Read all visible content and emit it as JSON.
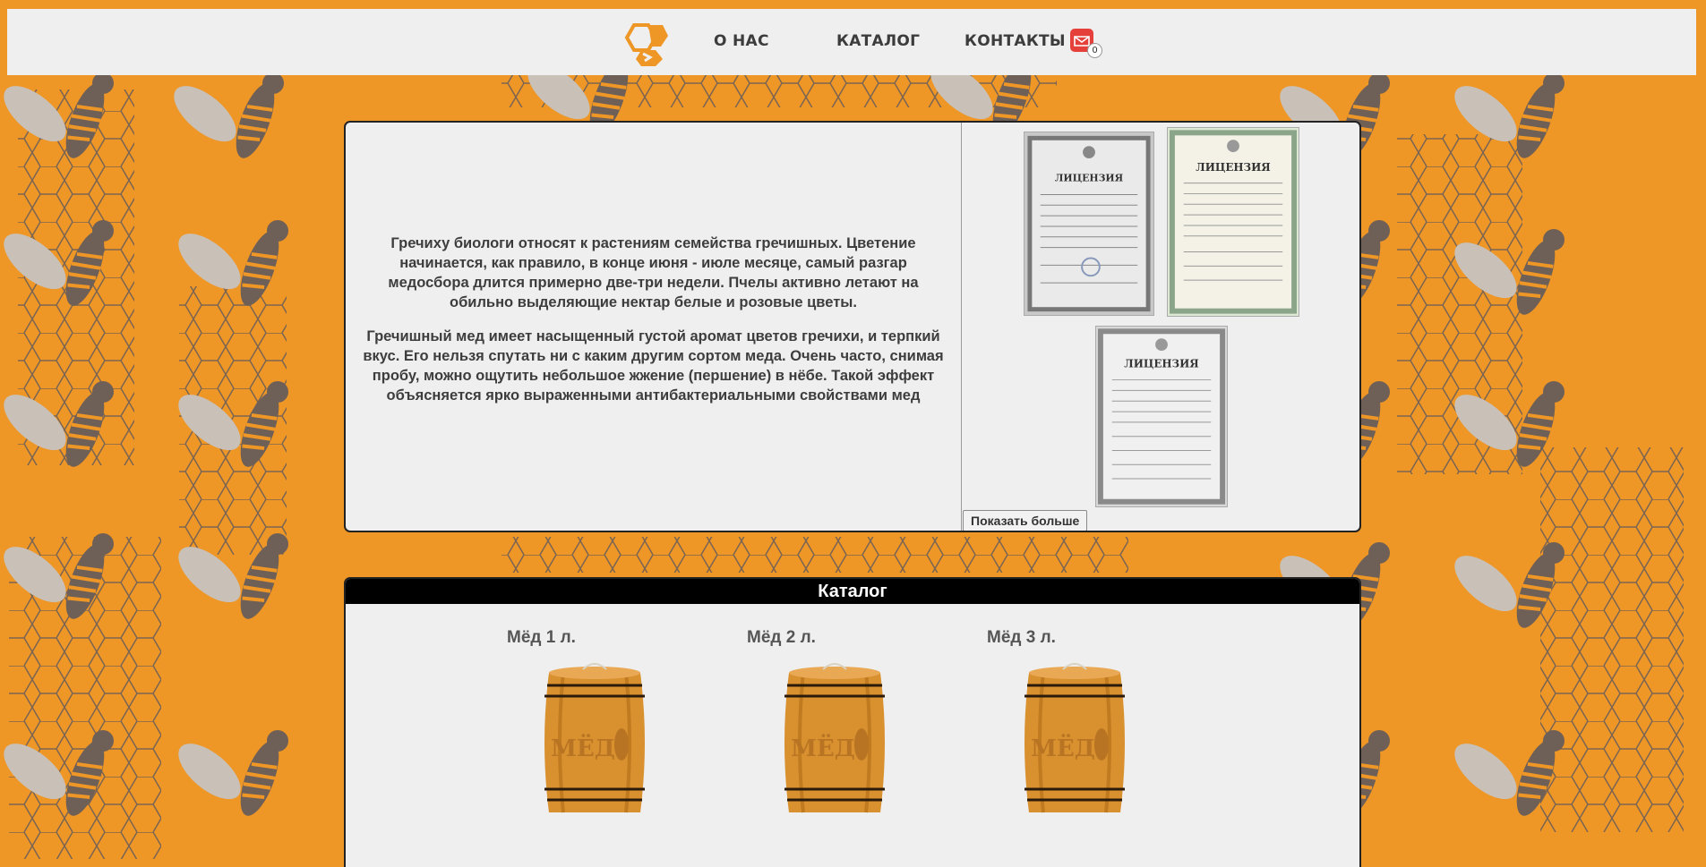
{
  "nav": {
    "logo_icon": "honeycomb-logo-icon",
    "about": "О НАС",
    "catalog": "КАТАЛОГ",
    "contacts": "КОНТАКТЫ",
    "cart_icon": "mail-cart-icon",
    "cart_count": "0"
  },
  "about": {
    "paragraph_1": "Гречиху биологи относят к растениям семейства гречишных. Цветение начинается, как правило, в конце июня - июле месяце, самый разгар медосбора длится примерно две-три недели. Пчелы активно летают на обильно выделяющие нектар белые и розовые цветы.",
    "paragraph_2": "Гречишный мед имеет насыщенный густой аромат цветов гречихи, и терпкий вкус. Его нельзя спутать ни с каким другим сортом меда. Очень часто, снимая пробу, можно ощутить небольшое жжение (першение) в нёбе. Такой эффект объясняется ярко выраженными антибактериальными свойствами мед",
    "certificates": [
      {
        "title": "ЛИЦЕНЗИЯ"
      },
      {
        "title": "ЛИЦЕНЗИЯ"
      },
      {
        "title": "ЛИЦЕНЗИЯ"
      }
    ],
    "show_more": "Показать больше"
  },
  "catalog": {
    "header": "Каталог",
    "products": [
      {
        "title": "Мёд 1 л.",
        "barrel_text": "МЁД"
      },
      {
        "title": "Мёд 2 л.",
        "barrel_text": "МЁД"
      },
      {
        "title": "Мёд 3 л.",
        "barrel_text": "МЁД"
      }
    ]
  },
  "colors": {
    "background": "#ee9626",
    "bee": "#6e5f57",
    "bee_wing": "#c9c0b8",
    "honeycomb_line": "#6e5f57",
    "panel": "#efefef"
  }
}
